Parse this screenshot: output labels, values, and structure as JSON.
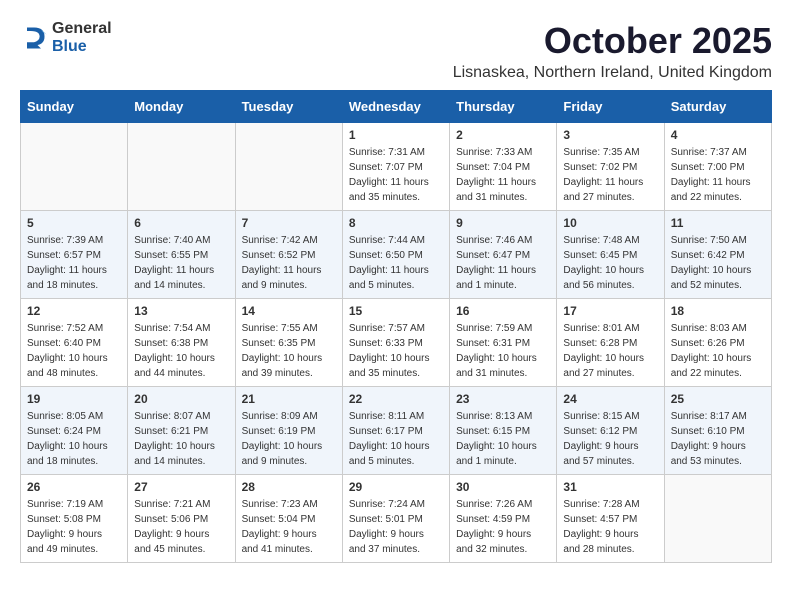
{
  "header": {
    "logo_general": "General",
    "logo_blue": "Blue",
    "month_title": "October 2025",
    "location": "Lisnaskea, Northern Ireland, United Kingdom"
  },
  "days_of_week": [
    "Sunday",
    "Monday",
    "Tuesday",
    "Wednesday",
    "Thursday",
    "Friday",
    "Saturday"
  ],
  "weeks": [
    [
      {
        "day": "",
        "info": ""
      },
      {
        "day": "",
        "info": ""
      },
      {
        "day": "",
        "info": ""
      },
      {
        "day": "1",
        "info": "Sunrise: 7:31 AM\nSunset: 7:07 PM\nDaylight: 11 hours\nand 35 minutes."
      },
      {
        "day": "2",
        "info": "Sunrise: 7:33 AM\nSunset: 7:04 PM\nDaylight: 11 hours\nand 31 minutes."
      },
      {
        "day": "3",
        "info": "Sunrise: 7:35 AM\nSunset: 7:02 PM\nDaylight: 11 hours\nand 27 minutes."
      },
      {
        "day": "4",
        "info": "Sunrise: 7:37 AM\nSunset: 7:00 PM\nDaylight: 11 hours\nand 22 minutes."
      }
    ],
    [
      {
        "day": "5",
        "info": "Sunrise: 7:39 AM\nSunset: 6:57 PM\nDaylight: 11 hours\nand 18 minutes."
      },
      {
        "day": "6",
        "info": "Sunrise: 7:40 AM\nSunset: 6:55 PM\nDaylight: 11 hours\nand 14 minutes."
      },
      {
        "day": "7",
        "info": "Sunrise: 7:42 AM\nSunset: 6:52 PM\nDaylight: 11 hours\nand 9 minutes."
      },
      {
        "day": "8",
        "info": "Sunrise: 7:44 AM\nSunset: 6:50 PM\nDaylight: 11 hours\nand 5 minutes."
      },
      {
        "day": "9",
        "info": "Sunrise: 7:46 AM\nSunset: 6:47 PM\nDaylight: 11 hours\nand 1 minute."
      },
      {
        "day": "10",
        "info": "Sunrise: 7:48 AM\nSunset: 6:45 PM\nDaylight: 10 hours\nand 56 minutes."
      },
      {
        "day": "11",
        "info": "Sunrise: 7:50 AM\nSunset: 6:42 PM\nDaylight: 10 hours\nand 52 minutes."
      }
    ],
    [
      {
        "day": "12",
        "info": "Sunrise: 7:52 AM\nSunset: 6:40 PM\nDaylight: 10 hours\nand 48 minutes."
      },
      {
        "day": "13",
        "info": "Sunrise: 7:54 AM\nSunset: 6:38 PM\nDaylight: 10 hours\nand 44 minutes."
      },
      {
        "day": "14",
        "info": "Sunrise: 7:55 AM\nSunset: 6:35 PM\nDaylight: 10 hours\nand 39 minutes."
      },
      {
        "day": "15",
        "info": "Sunrise: 7:57 AM\nSunset: 6:33 PM\nDaylight: 10 hours\nand 35 minutes."
      },
      {
        "day": "16",
        "info": "Sunrise: 7:59 AM\nSunset: 6:31 PM\nDaylight: 10 hours\nand 31 minutes."
      },
      {
        "day": "17",
        "info": "Sunrise: 8:01 AM\nSunset: 6:28 PM\nDaylight: 10 hours\nand 27 minutes."
      },
      {
        "day": "18",
        "info": "Sunrise: 8:03 AM\nSunset: 6:26 PM\nDaylight: 10 hours\nand 22 minutes."
      }
    ],
    [
      {
        "day": "19",
        "info": "Sunrise: 8:05 AM\nSunset: 6:24 PM\nDaylight: 10 hours\nand 18 minutes."
      },
      {
        "day": "20",
        "info": "Sunrise: 8:07 AM\nSunset: 6:21 PM\nDaylight: 10 hours\nand 14 minutes."
      },
      {
        "day": "21",
        "info": "Sunrise: 8:09 AM\nSunset: 6:19 PM\nDaylight: 10 hours\nand 9 minutes."
      },
      {
        "day": "22",
        "info": "Sunrise: 8:11 AM\nSunset: 6:17 PM\nDaylight: 10 hours\nand 5 minutes."
      },
      {
        "day": "23",
        "info": "Sunrise: 8:13 AM\nSunset: 6:15 PM\nDaylight: 10 hours\nand 1 minute."
      },
      {
        "day": "24",
        "info": "Sunrise: 8:15 AM\nSunset: 6:12 PM\nDaylight: 9 hours\nand 57 minutes."
      },
      {
        "day": "25",
        "info": "Sunrise: 8:17 AM\nSunset: 6:10 PM\nDaylight: 9 hours\nand 53 minutes."
      }
    ],
    [
      {
        "day": "26",
        "info": "Sunrise: 7:19 AM\nSunset: 5:08 PM\nDaylight: 9 hours\nand 49 minutes."
      },
      {
        "day": "27",
        "info": "Sunrise: 7:21 AM\nSunset: 5:06 PM\nDaylight: 9 hours\nand 45 minutes."
      },
      {
        "day": "28",
        "info": "Sunrise: 7:23 AM\nSunset: 5:04 PM\nDaylight: 9 hours\nand 41 minutes."
      },
      {
        "day": "29",
        "info": "Sunrise: 7:24 AM\nSunset: 5:01 PM\nDaylight: 9 hours\nand 37 minutes."
      },
      {
        "day": "30",
        "info": "Sunrise: 7:26 AM\nSunset: 4:59 PM\nDaylight: 9 hours\nand 32 minutes."
      },
      {
        "day": "31",
        "info": "Sunrise: 7:28 AM\nSunset: 4:57 PM\nDaylight: 9 hours\nand 28 minutes."
      },
      {
        "day": "",
        "info": ""
      }
    ]
  ]
}
